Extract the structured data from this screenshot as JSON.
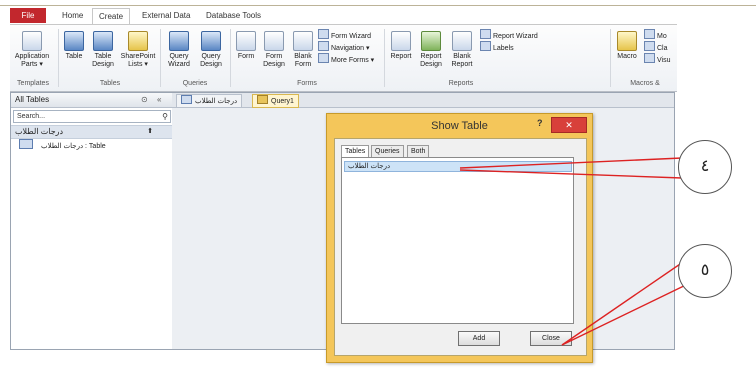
{
  "ribbon_tabs": [
    "File",
    "Home",
    "Create",
    "External Data",
    "Database Tools"
  ],
  "ribbon": {
    "templates": {
      "app_parts": "Application\nParts ▾",
      "group": "Templates"
    },
    "tables": {
      "table": "Table",
      "table_design": "Table\nDesign",
      "sharepoint": "SharePoint\nLists ▾",
      "group": "Tables"
    },
    "queries": {
      "wizard": "Query\nWizard",
      "design": "Query\nDesign",
      "group": "Queries"
    },
    "forms": {
      "form": "Form",
      "form_design": "Form\nDesign",
      "blank_form": "Blank\nForm",
      "form_wizard": "Form Wizard",
      "navigation": "Navigation ▾",
      "more_forms": "More Forms ▾",
      "group": "Forms"
    },
    "reports": {
      "report": "Report",
      "report_design": "Report\nDesign",
      "blank_report": "Blank\nReport",
      "report_wizard": "Report Wizard",
      "labels": "Labels",
      "group": "Reports"
    },
    "macros": {
      "macro": "Macro",
      "mo": "Mo",
      "cl": "Cla",
      "vi": "Visu",
      "group": "Macros &"
    }
  },
  "nav": {
    "header": "All Tables",
    "search_placeholder": "Search...",
    "group": "درجات الطلاب",
    "item": "درجات الطلاب : Table"
  },
  "doc_tabs": [
    "درجات الطلاب",
    "Query1"
  ],
  "dialog": {
    "title": "Show Table",
    "help": "?",
    "tabs": [
      "Tables",
      "Queries",
      "Both"
    ],
    "list_item": "درجات الطلاب",
    "add": "Add",
    "close": "Close"
  },
  "callouts": [
    "٤",
    "٥"
  ]
}
